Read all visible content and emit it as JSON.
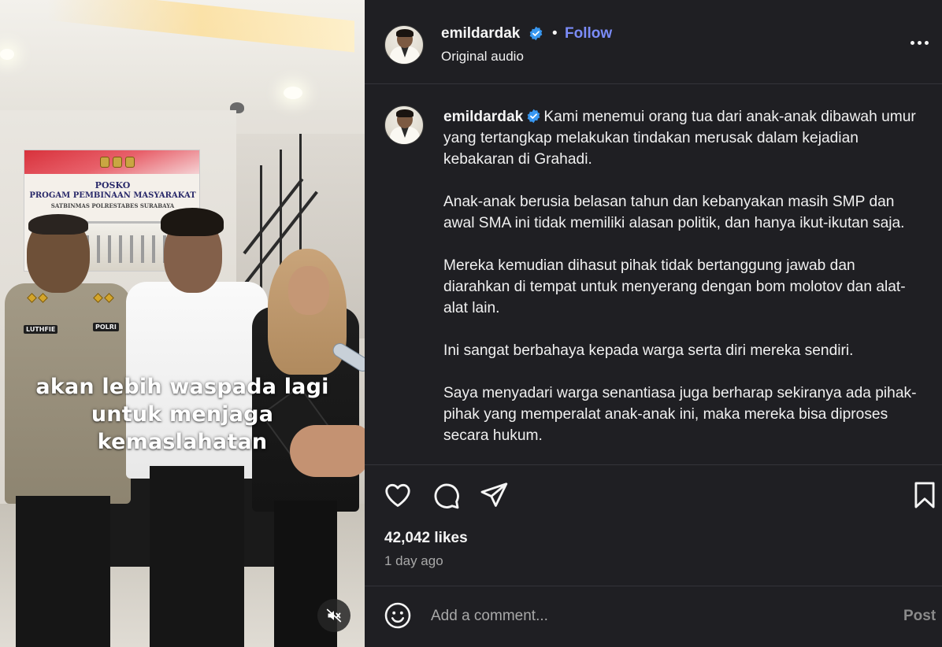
{
  "video": {
    "subtitle_lines": [
      "akan lebih waspada lagi",
      "untuk menjaga",
      "kemaslahatan"
    ],
    "banner": {
      "title_line1": "POSKO",
      "title_line2": "PROGAM PEMBINAAN MASYARAKAT",
      "title_line3": "SATBINMAS POLRESTABES SURABAYA"
    },
    "officer_badges": [
      "LUTHFIE",
      "POLRI"
    ],
    "mute_icon": "speaker-muted-icon"
  },
  "header": {
    "username": "emildardak",
    "separator": "•",
    "follow_label": "Follow",
    "audio_label": "Original audio",
    "verified_color": "#3897f0",
    "follow_color": "#7b8cf8"
  },
  "caption": {
    "username": "emildardak",
    "paragraphs": [
      "Kami menemui orang tua dari anak-anak dibawah umur yang tertangkap melakukan tindakan merusak dalam kejadian kebakaran di Grahadi.",
      "Anak-anak berusia belasan tahun dan kebanyakan masih SMP dan awal SMA ini tidak memiliki alasan politik, dan hanya ikut-ikutan saja.",
      "Mereka kemudian dihasut pihak tidak bertanggung jawab dan diarahkan di tempat untuk menyerang dengan bom molotov dan alat-alat lain.",
      "Ini sangat berbahaya kepada warga serta diri mereka sendiri.",
      "Saya menyadari warga senantiasa juga berharap sekiranya ada pihak-pihak yang memperalat anak-anak ini, maka mereka bisa diproses secara hukum."
    ]
  },
  "actions": {
    "icons": [
      "heart-icon",
      "comment-icon",
      "share-icon",
      "bookmark-icon"
    ]
  },
  "stats": {
    "likes": "42,042 likes",
    "time_ago": "1 day ago"
  },
  "comment": {
    "placeholder": "Add a comment...",
    "post_label": "Post"
  },
  "colors": {
    "background": "#1f1f23",
    "text": "#f5f5f5",
    "muted_text": "#a8a8a8"
  }
}
